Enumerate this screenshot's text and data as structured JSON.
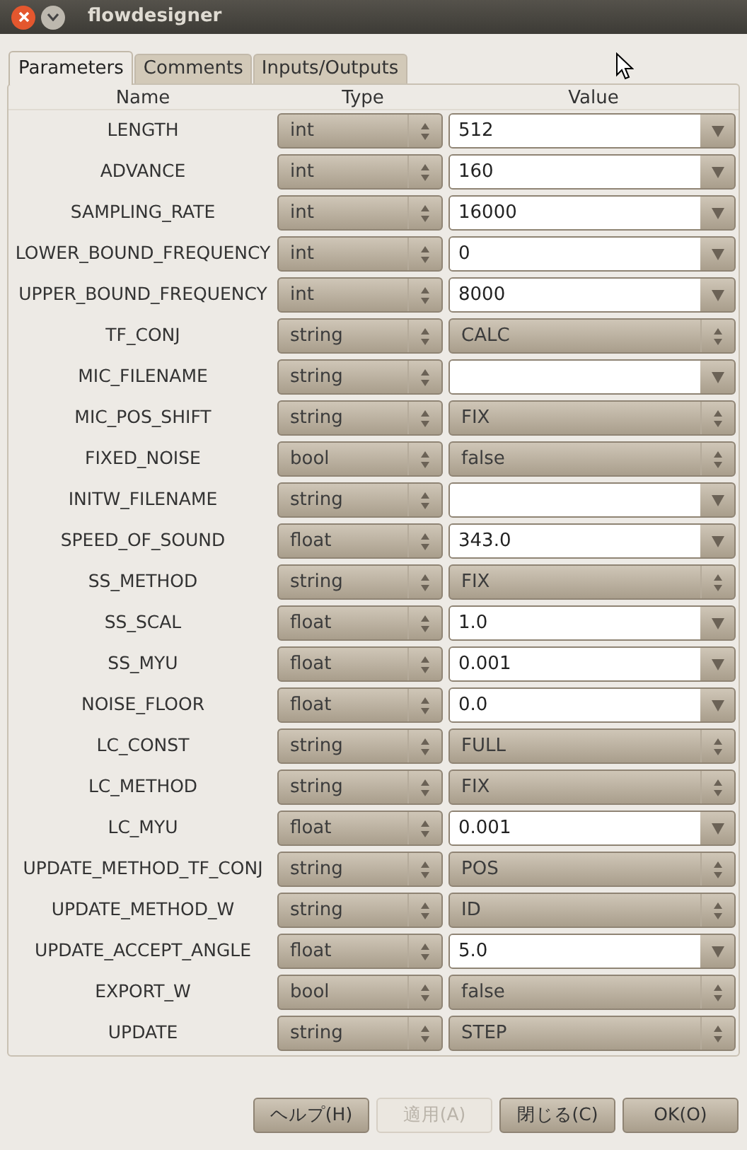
{
  "window": {
    "title": "flowdesigner"
  },
  "tabs": [
    {
      "label": "Parameters",
      "selected": true
    },
    {
      "label": "Comments",
      "selected": false
    },
    {
      "label": "Inputs/Outputs",
      "selected": false
    }
  ],
  "table": {
    "columns": [
      "Name",
      "Type",
      "Value"
    ],
    "rows": [
      {
        "name": "LENGTH",
        "type": "int",
        "value": "512",
        "kind": "entry"
      },
      {
        "name": "ADVANCE",
        "type": "int",
        "value": "160",
        "kind": "entry"
      },
      {
        "name": "SAMPLING_RATE",
        "type": "int",
        "value": "16000",
        "kind": "entry"
      },
      {
        "name": "LOWER_BOUND_FREQUENCY",
        "type": "int",
        "value": "0",
        "kind": "entry"
      },
      {
        "name": "UPPER_BOUND_FREQUENCY",
        "type": "int",
        "value": "8000",
        "kind": "entry"
      },
      {
        "name": "TF_CONJ",
        "type": "string",
        "value": "CALC",
        "kind": "choice"
      },
      {
        "name": "MIC_FILENAME",
        "type": "string",
        "kind": "entry"
      },
      {
        "name": "MIC_POS_SHIFT",
        "type": "string",
        "value": "FIX",
        "kind": "choice"
      },
      {
        "name": "FIXED_NOISE",
        "type": "bool",
        "value": "false",
        "kind": "choice"
      },
      {
        "name": "INITW_FILENAME",
        "type": "string",
        "kind": "entry"
      },
      {
        "name": "SPEED_OF_SOUND",
        "type": "float",
        "value": "343.0",
        "kind": "entry"
      },
      {
        "name": "SS_METHOD",
        "type": "string",
        "value": "FIX",
        "kind": "choice"
      },
      {
        "name": "SS_SCAL",
        "type": "float",
        "value": "1.0",
        "kind": "entry"
      },
      {
        "name": "SS_MYU",
        "type": "float",
        "value": "0.001",
        "kind": "entry"
      },
      {
        "name": "NOISE_FLOOR",
        "type": "float",
        "value": "0.0",
        "kind": "entry"
      },
      {
        "name": "LC_CONST",
        "type": "string",
        "value": "FULL",
        "kind": "choice"
      },
      {
        "name": "LC_METHOD",
        "type": "string",
        "value": "FIX",
        "kind": "choice"
      },
      {
        "name": "LC_MYU",
        "type": "float",
        "value": "0.001",
        "kind": "entry"
      },
      {
        "name": "UPDATE_METHOD_TF_CONJ",
        "type": "string",
        "value": "POS",
        "kind": "choice"
      },
      {
        "name": "UPDATE_METHOD_W",
        "type": "string",
        "value": "ID",
        "kind": "choice"
      },
      {
        "name": "UPDATE_ACCEPT_ANGLE",
        "type": "float",
        "value": "5.0",
        "kind": "entry"
      },
      {
        "name": "EXPORT_W",
        "type": "bool",
        "value": "false",
        "kind": "choice"
      },
      {
        "name": "UPDATE",
        "type": "string",
        "value": "STEP",
        "kind": "choice"
      }
    ]
  },
  "buttons": [
    {
      "label": "ヘルプ(H)",
      "disabled": false
    },
    {
      "label": "適用(A)",
      "disabled": true
    },
    {
      "label": "閉じる(C)",
      "disabled": false
    },
    {
      "label": "OK(O)",
      "disabled": false
    }
  ]
}
